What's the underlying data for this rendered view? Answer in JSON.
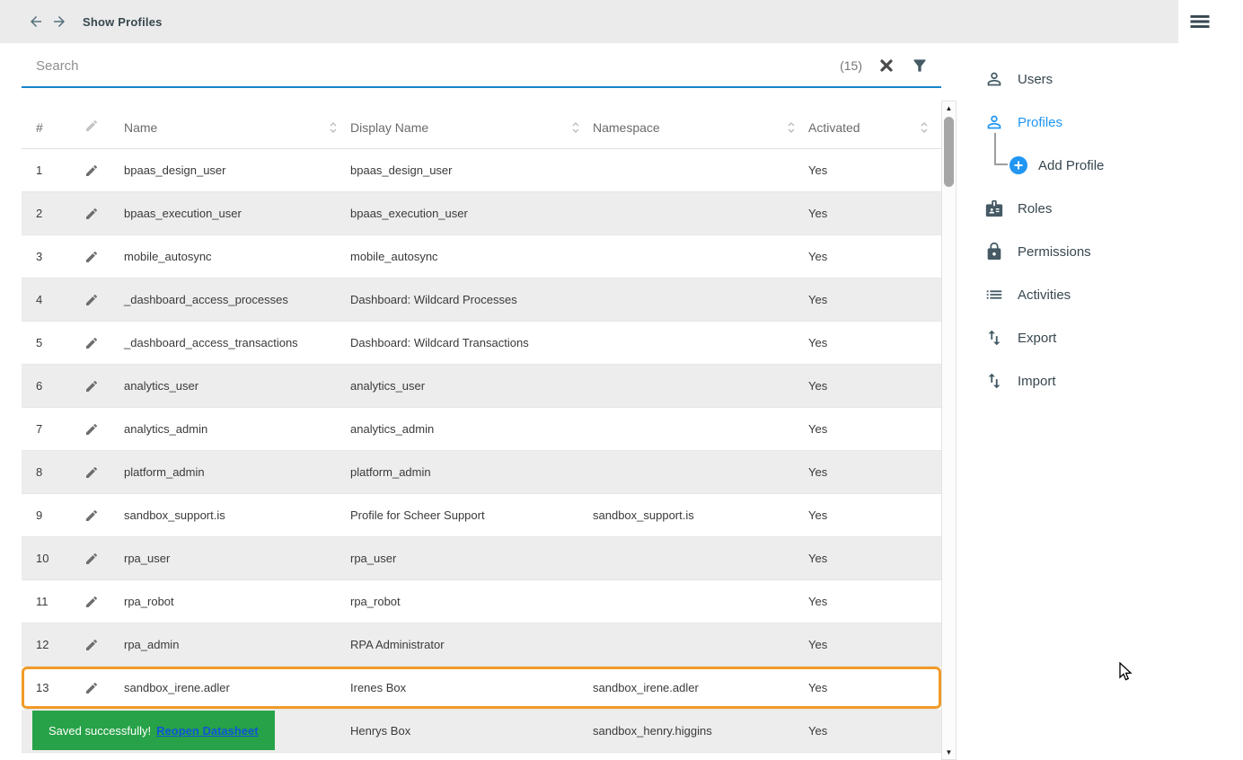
{
  "topbar": {
    "title": "Show Profiles"
  },
  "search": {
    "placeholder": "Search",
    "count": "(15)"
  },
  "table": {
    "columns": {
      "num": "#",
      "name": "Name",
      "display_name": "Display Name",
      "namespace": "Namespace",
      "activated": "Activated"
    },
    "rows": [
      {
        "num": "1",
        "name": "bpaas_design_user",
        "display_name": "bpaas_design_user",
        "namespace": "",
        "activated": "Yes"
      },
      {
        "num": "2",
        "name": "bpaas_execution_user",
        "display_name": "bpaas_execution_user",
        "namespace": "",
        "activated": "Yes"
      },
      {
        "num": "3",
        "name": "mobile_autosync",
        "display_name": "mobile_autosync",
        "namespace": "",
        "activated": "Yes"
      },
      {
        "num": "4",
        "name": "_dashboard_access_processes",
        "display_name": "Dashboard: Wildcard Processes",
        "namespace": "",
        "activated": "Yes"
      },
      {
        "num": "5",
        "name": "_dashboard_access_transactions",
        "display_name": "Dashboard: Wildcard Transactions",
        "namespace": "",
        "activated": "Yes"
      },
      {
        "num": "6",
        "name": "analytics_user",
        "display_name": "analytics_user",
        "namespace": "",
        "activated": "Yes"
      },
      {
        "num": "7",
        "name": "analytics_admin",
        "display_name": "analytics_admin",
        "namespace": "",
        "activated": "Yes"
      },
      {
        "num": "8",
        "name": "platform_admin",
        "display_name": "platform_admin",
        "namespace": "",
        "activated": "Yes"
      },
      {
        "num": "9",
        "name": "sandbox_support.is",
        "display_name": "Profile for Scheer Support",
        "namespace": "sandbox_support.is",
        "activated": "Yes"
      },
      {
        "num": "10",
        "name": "rpa_user",
        "display_name": "rpa_user",
        "namespace": "",
        "activated": "Yes"
      },
      {
        "num": "11",
        "name": "rpa_robot",
        "display_name": "rpa_robot",
        "namespace": "",
        "activated": "Yes"
      },
      {
        "num": "12",
        "name": "rpa_admin",
        "display_name": "RPA Administrator",
        "namespace": "",
        "activated": "Yes"
      },
      {
        "num": "13",
        "name": "sandbox_irene.adler",
        "display_name": "Irenes Box",
        "namespace": "sandbox_irene.adler",
        "activated": "Yes",
        "highlighted": true
      },
      {
        "num": "",
        "name": "",
        "display_name": "Henrys Box",
        "namespace": "sandbox_henry.higgins",
        "activated": "Yes"
      }
    ]
  },
  "toast": {
    "message": "Saved successfully!",
    "link_label": "Reopen Datasheet"
  },
  "sidebar": {
    "items": [
      {
        "label": "Users",
        "icon": "user-icon",
        "active": false
      },
      {
        "label": "Profiles",
        "icon": "profile-icon",
        "active": true
      },
      {
        "label": "Add Profile",
        "icon": "add-circle-icon",
        "active": false
      },
      {
        "label": "Roles",
        "icon": "badge-icon",
        "active": false
      },
      {
        "label": "Permissions",
        "icon": "lock-icon",
        "active": false
      },
      {
        "label": "Activities",
        "icon": "list-icon",
        "active": false
      },
      {
        "label": "Export",
        "icon": "import-export-icon",
        "active": false
      },
      {
        "label": "Import",
        "icon": "import-export-icon",
        "active": false
      }
    ]
  },
  "colors": {
    "accent_blue": "#2196f3",
    "search_underline": "#1584cc",
    "highlight_orange": "#f09b28",
    "toast_green": "#27a248",
    "link_blue": "#1053d6",
    "topbar_bg": "#ebebeb",
    "row_alt_bg": "#ededed"
  }
}
